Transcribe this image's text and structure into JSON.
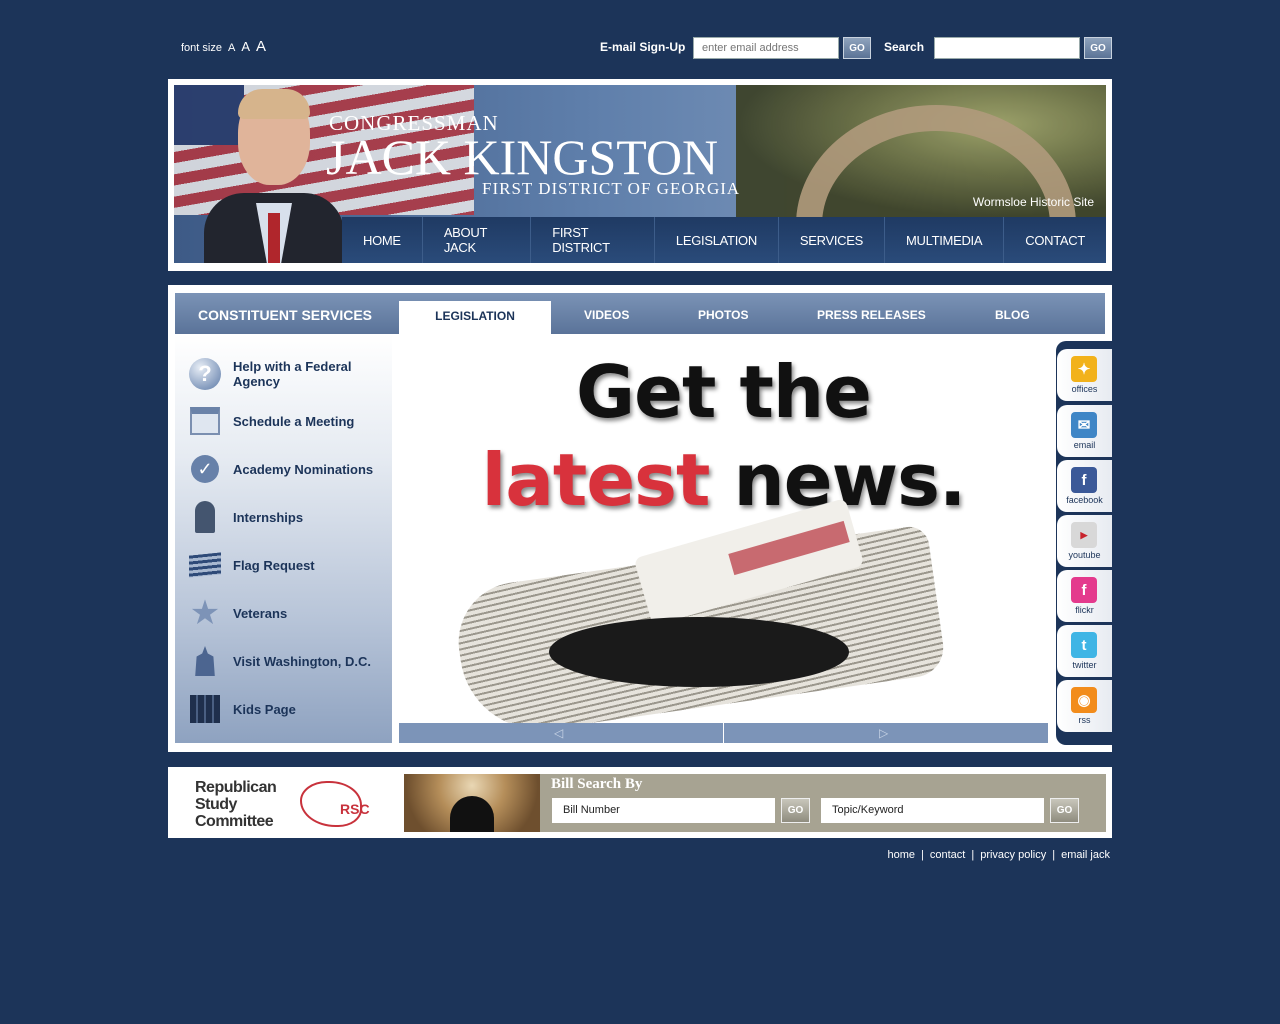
{
  "topbar": {
    "font_size_label": "font size",
    "font_a_small": "A",
    "font_a_medium": "A",
    "font_a_large": "A",
    "signup_label": "E-mail Sign-Up",
    "email_placeholder": "enter email address",
    "go_label": "GO",
    "search_label": "Search"
  },
  "header": {
    "congressman": "CONGRESSMAN",
    "name": "JACK KINGSTON",
    "district": "FIRST DISTRICT OF GEORGIA",
    "caption": "Wormsloe Historic Site",
    "nav": [
      "HOME",
      "ABOUT JACK",
      "FIRST DISTRICT",
      "LEGISLATION",
      "SERVICES",
      "MULTIMEDIA",
      "CONTACT"
    ]
  },
  "tabs": {
    "section_title": "CONSTITUENT SERVICES",
    "items": [
      "LEGISLATION",
      "VIDEOS",
      "PHOTOS",
      "PRESS RELEASES",
      "BLOG"
    ],
    "active": "LEGISLATION"
  },
  "services": [
    "Help with a Federal Agency",
    "Schedule a Meeting",
    "Academy Nominations",
    "Internships",
    "Flag Request",
    "Veterans",
    "Visit Washington, D.C.",
    "Kids Page"
  ],
  "feature": {
    "line1": "Get the",
    "line2_red": "latest",
    "line2_black": "news."
  },
  "social": [
    {
      "label": "offices",
      "icon": "pin-icon",
      "color": "#f2b21b"
    },
    {
      "label": "email",
      "icon": "envelope-icon",
      "color": "#3f86c6"
    },
    {
      "label": "facebook",
      "icon": "facebook-icon",
      "color": "#3b5998"
    },
    {
      "label": "youtube",
      "icon": "youtube-icon",
      "color": "#d8d8d8"
    },
    {
      "label": "flickr",
      "icon": "flickr-icon",
      "color": "#e43a8d"
    },
    {
      "label": "twitter",
      "icon": "twitter-icon",
      "color": "#3fb5e5"
    },
    {
      "label": "rss",
      "icon": "rss-icon",
      "color": "#f28c1b"
    }
  ],
  "bottom": {
    "rsc_line1": "Republican",
    "rsc_line2": "Study",
    "rsc_line3": "Committee",
    "rsc_logo": "RSC",
    "bill_search_title": "Bill Search By",
    "bill_number_value": "Bill Number",
    "topic_value": "Topic/Keyword",
    "go_label": "GO"
  },
  "footer_links": [
    "home",
    "contact",
    "privacy policy",
    "email jack"
  ]
}
